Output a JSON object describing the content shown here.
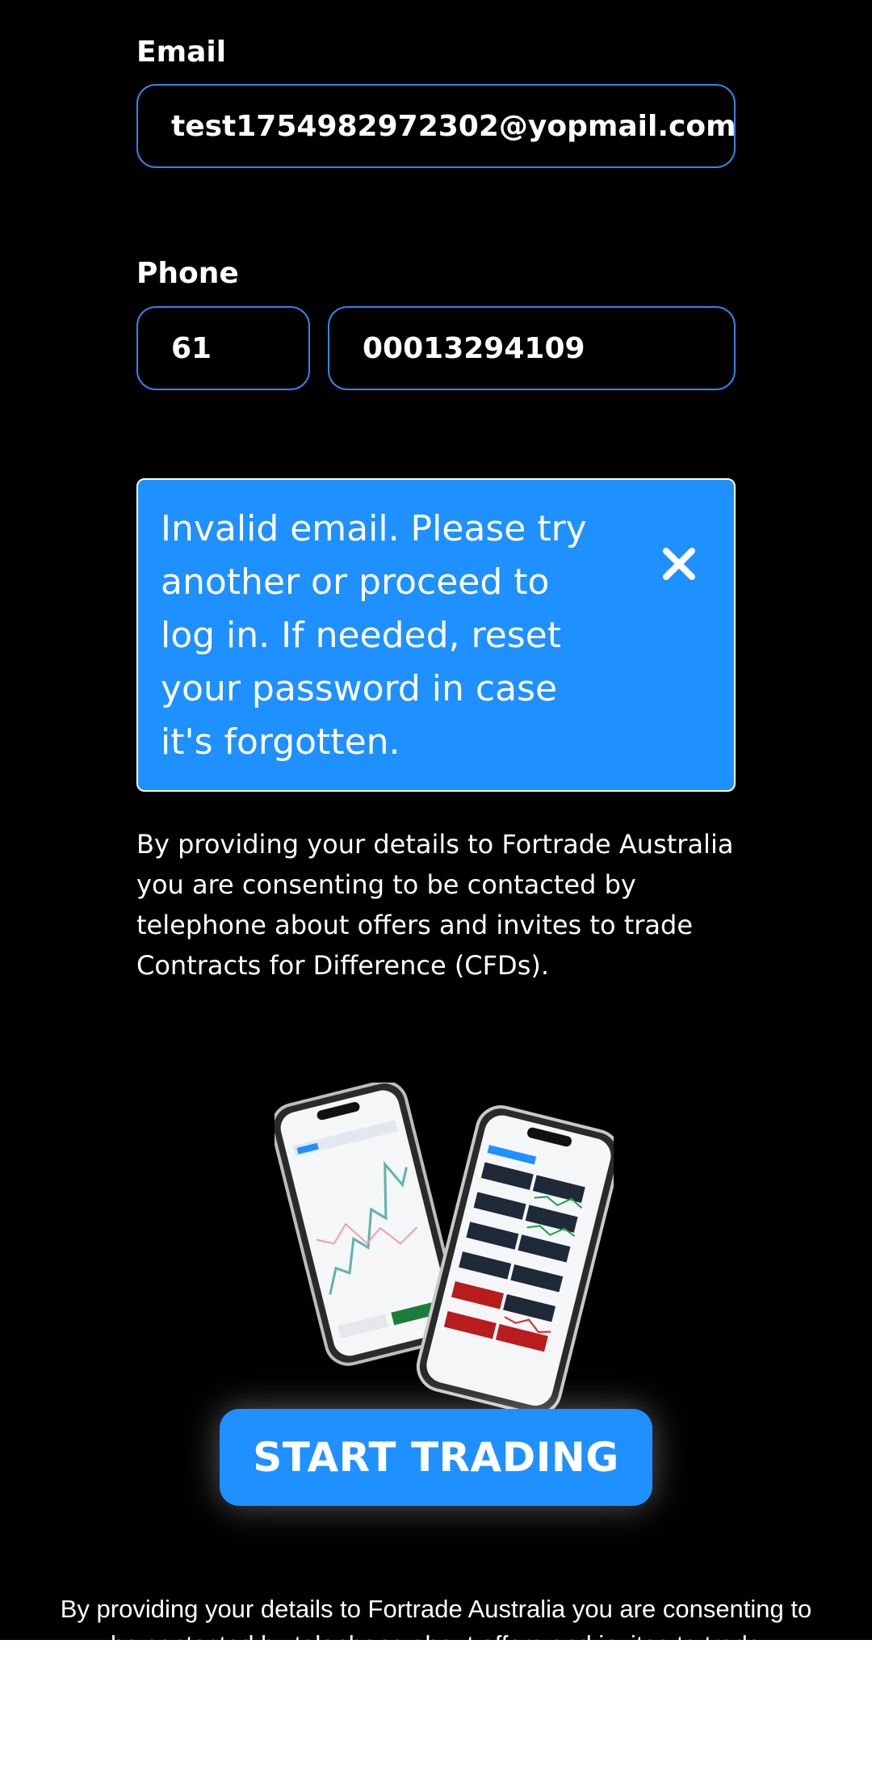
{
  "email": {
    "label": "Email",
    "value": "test1754982972302@yopmail.com"
  },
  "phone": {
    "label": "Phone",
    "country_code": "61",
    "number": "00013294109"
  },
  "alert": {
    "message": "Invalid email. Please try another or proceed to log in. If needed, reset your password in case it's forgotten.",
    "close_icon": "close-icon"
  },
  "consent": {
    "text": "By providing your details to Fortrade Australia you are consenting to be contacted by telephone about offers and invites to trade Contracts for Difference (CFDs)."
  },
  "cta": {
    "label": "START TRADING"
  },
  "footer": {
    "consent_text": "By providing your details to Fortrade Australia you are consenting to be contacted by telephone about offers and invites to trade"
  },
  "colors": {
    "background": "#000000",
    "accent": "#1e90ff",
    "input_border": "#2f86ea",
    "text": "#ffffff"
  }
}
